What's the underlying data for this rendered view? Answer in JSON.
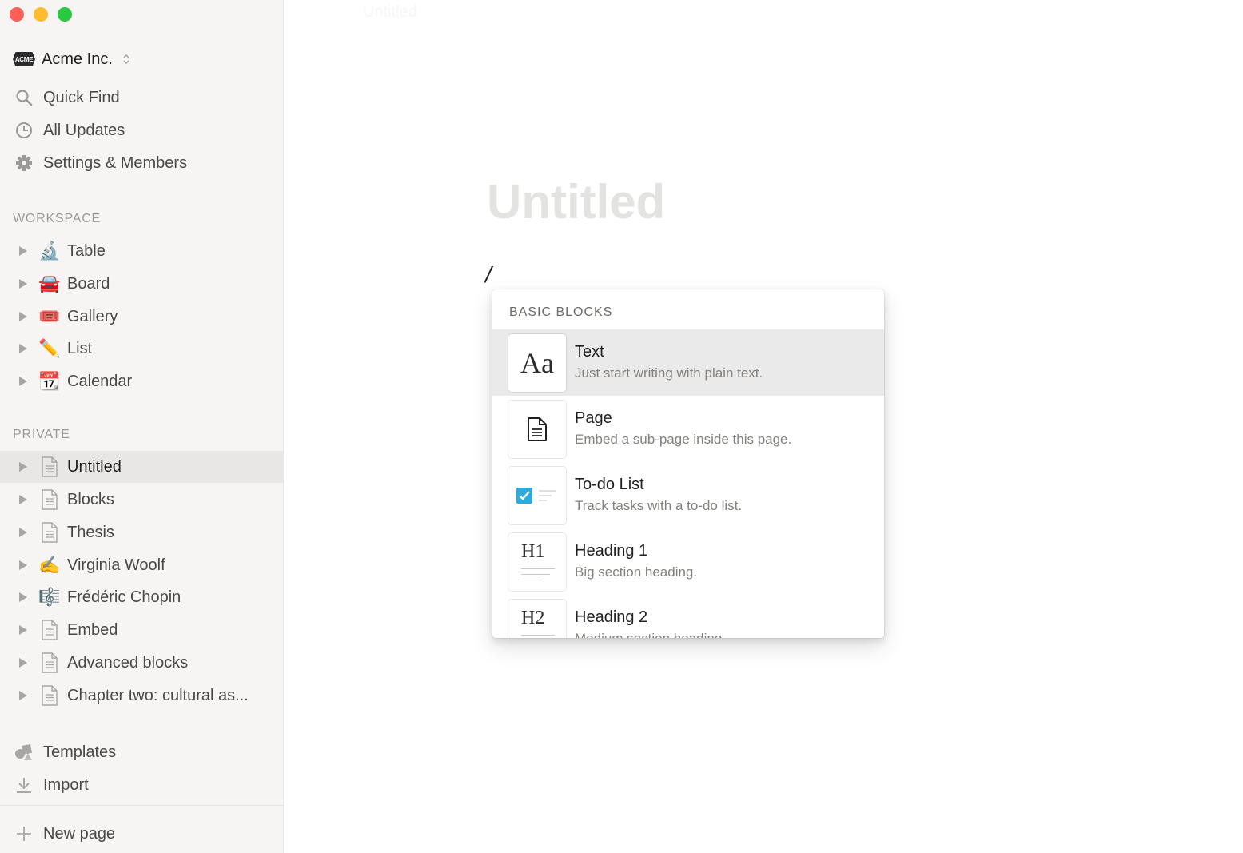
{
  "window": {
    "header_title": "Untitled"
  },
  "sidebar": {
    "workspace": {
      "logo_text": "ACME",
      "name": "Acme Inc."
    },
    "nav": [
      {
        "label": "Quick Find",
        "icon": "search-icon"
      },
      {
        "label": "All Updates",
        "icon": "clock-icon"
      },
      {
        "label": "Settings & Members",
        "icon": "gear-icon"
      }
    ],
    "workspace_section": {
      "label": "WORKSPACE",
      "items": [
        {
          "label": "Table",
          "icon": "microscope-icon",
          "emoji": "🔬"
        },
        {
          "label": "Board",
          "icon": "car-icon",
          "emoji": "🚘"
        },
        {
          "label": "Gallery",
          "icon": "ticket-icon",
          "emoji": "🎟️"
        },
        {
          "label": "List",
          "icon": "pencil-icon",
          "emoji": "✏️"
        },
        {
          "label": "Calendar",
          "icon": "calendar-icon",
          "emoji": "📆"
        }
      ]
    },
    "private_section": {
      "label": "PRIVATE",
      "items": [
        {
          "label": "Untitled",
          "icon": "page-icon",
          "active": true
        },
        {
          "label": "Blocks",
          "icon": "page-icon"
        },
        {
          "label": "Thesis",
          "icon": "page-icon"
        },
        {
          "label": "Virginia Woolf",
          "icon": "writing-hand-icon",
          "emoji": "✍️"
        },
        {
          "label": "Frédéric Chopin",
          "icon": "music-score-icon",
          "emoji": "🎼"
        },
        {
          "label": "Embed",
          "icon": "page-icon"
        },
        {
          "label": "Advanced blocks",
          "icon": "page-icon"
        },
        {
          "label": "Chapter two: cultural as...",
          "icon": "page-icon"
        }
      ]
    },
    "footer": [
      {
        "label": "Templates",
        "icon": "shapes-icon"
      },
      {
        "label": "Import",
        "icon": "download-icon"
      }
    ],
    "new_page_label": "New page"
  },
  "page": {
    "title_placeholder": "Untitled",
    "current_input": "/"
  },
  "block_menu": {
    "section": "BASIC BLOCKS",
    "items": [
      {
        "title": "Text",
        "description": "Just start writing with plain text.",
        "icon": "text-icon",
        "glyph": "Aa",
        "highlighted": true
      },
      {
        "title": "Page",
        "description": "Embed a sub-page inside this page.",
        "icon": "page-icon"
      },
      {
        "title": "To-do List",
        "description": "Track tasks with a to-do list.",
        "icon": "checkbox-icon"
      },
      {
        "title": "Heading 1",
        "description": "Big section heading.",
        "icon": "heading1-icon",
        "glyph": "H1"
      },
      {
        "title": "Heading 2",
        "description": "Medium section heading.",
        "icon": "heading2-icon",
        "glyph": "H2"
      }
    ],
    "accent_color": "#2eaadc"
  }
}
